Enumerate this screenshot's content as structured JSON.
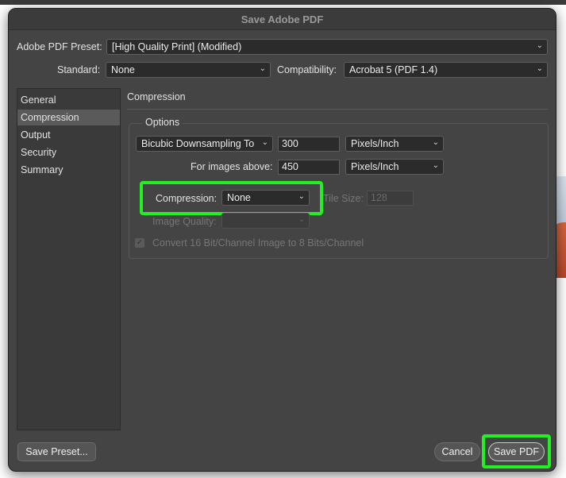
{
  "dialog": {
    "title": "Save Adobe PDF"
  },
  "preset": {
    "label": "Adobe PDF Preset:",
    "value": "[High Quality Print] (Modified)"
  },
  "standard": {
    "label": "Standard:",
    "value": "None"
  },
  "compatibility": {
    "label": "Compatibility:",
    "value": "Acrobat 5 (PDF 1.4)"
  },
  "sidebar": {
    "items": [
      {
        "label": "General"
      },
      {
        "label": "Compression"
      },
      {
        "label": "Output"
      },
      {
        "label": "Security"
      },
      {
        "label": "Summary"
      }
    ],
    "active": "Compression"
  },
  "section": {
    "title": "Compression",
    "group_label": "Options"
  },
  "downsampling": {
    "method": "Bicubic Downsampling To",
    "resolution": "300",
    "unit": "Pixels/Inch",
    "above_label": "For images above:",
    "above_value": "450",
    "above_unit": "Pixels/Inch"
  },
  "compression": {
    "label": "Compression:",
    "value": "None"
  },
  "tile_size": {
    "label": "Tile Size:",
    "value": "128"
  },
  "image_quality": {
    "label": "Image Quality:",
    "value": ""
  },
  "convert_16bit": {
    "label": "Convert 16 Bit/Channel Image to 8 Bits/Channel",
    "checked": true
  },
  "buttons": {
    "save_preset": "Save Preset...",
    "cancel": "Cancel",
    "save_pdf": "Save PDF"
  },
  "icons": {
    "chevron": "chevron-down-icon",
    "check": "checkmark-icon"
  },
  "colors": {
    "highlight": "#23f023",
    "dialog_bg": "#444444"
  }
}
